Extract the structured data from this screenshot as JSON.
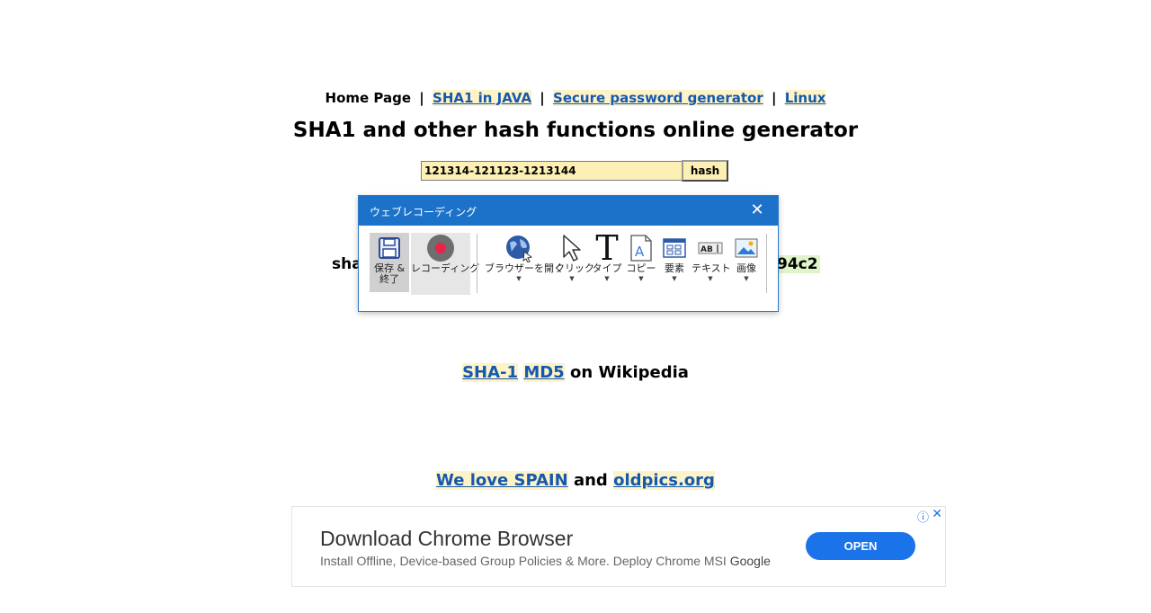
{
  "nav": {
    "home": "Home Page",
    "separator": "|",
    "links": [
      "SHA1 in JAVA",
      "Secure password generator",
      "Linux"
    ]
  },
  "page_title": "SHA1 and other hash functions online generator",
  "form": {
    "input_value": "121314-121123-1213144",
    "button_label": "hash"
  },
  "result": {
    "left_fragment": "sha",
    "right_fragment": "94c2"
  },
  "wiki": {
    "links": [
      "SHA-1",
      "MD5"
    ],
    "suffix": "on Wikipedia"
  },
  "love": {
    "link1": "We love SPAIN",
    "joiner": "and",
    "link2": "oldpics.org"
  },
  "ad": {
    "title": "Download Chrome Browser",
    "description": "Install Offline, Device-based Group Policies & More. Deploy Chrome MSI",
    "brand": "Google",
    "button": "OPEN",
    "info_icon": "info-icon",
    "close_icon": "close-icon"
  },
  "recorder": {
    "title": "ウェブレコーディング",
    "tools": {
      "save": "保存 & 終了",
      "record": "レコーディング",
      "open_browser": "ブラウザーを開く",
      "click": "クリック",
      "type": "タイプ",
      "copy": "コピー",
      "element": "要素",
      "text": "テキスト",
      "image": "画像"
    },
    "icons": [
      "floppy-disk-icon",
      "record-icon",
      "globe-icon",
      "cursor-icon",
      "type-icon",
      "copy-icon",
      "element-icon",
      "text-icon",
      "image-icon"
    ]
  },
  "colors": {
    "link": "#1558b0",
    "link_highlight": "#fdf3c6",
    "recorder_titlebar": "#1b72c8",
    "record_dot": "#e8234a",
    "ad_button": "#1a73e8"
  }
}
